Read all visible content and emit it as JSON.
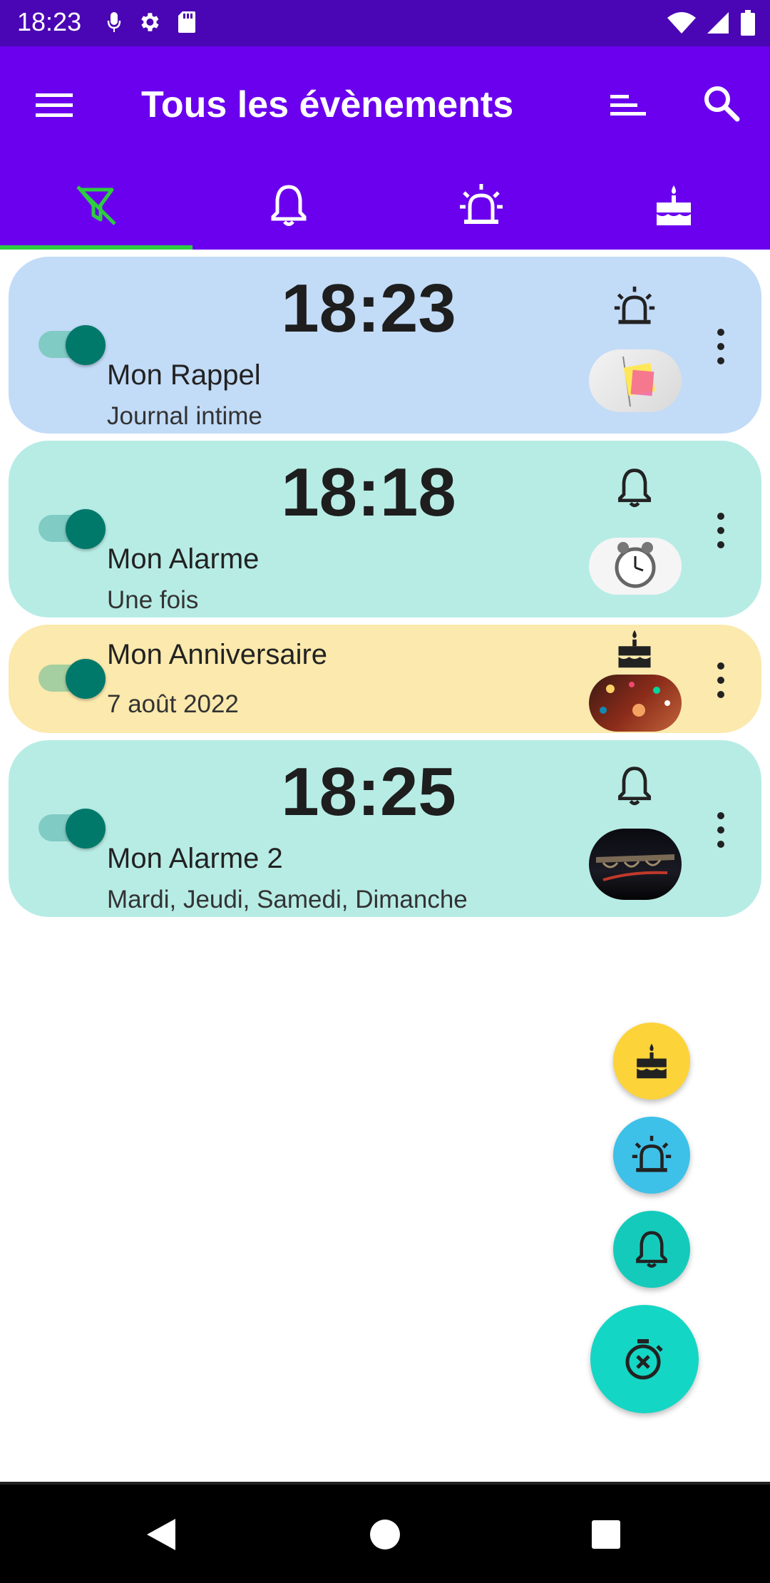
{
  "status_bar": {
    "time": "18:23",
    "left_icons": [
      "mic-icon",
      "settings-icon",
      "sd-card-icon"
    ],
    "right_icons": [
      "wifi-icon",
      "signal-icon",
      "battery-icon"
    ]
  },
  "app_bar": {
    "title": "Tous les évènements",
    "menu_icon": "menu-icon",
    "sort_icon": "sort-icon",
    "search_icon": "search-icon"
  },
  "tabs": [
    {
      "icon": "filter-off-icon",
      "selected": true
    },
    {
      "icon": "bell-icon",
      "selected": false
    },
    {
      "icon": "siren-icon",
      "selected": false
    },
    {
      "icon": "cake-icon",
      "selected": false
    }
  ],
  "events": [
    {
      "time": "18:23",
      "name": "Mon Rappel",
      "detail": "Journal intime",
      "type_icon": "siren-icon",
      "enabled": true,
      "color": "#c2dbf7",
      "thumb": "sticky-note"
    },
    {
      "time": "18:18",
      "name": "Mon Alarme",
      "detail": "Une fois",
      "type_icon": "bell-icon",
      "enabled": true,
      "color": "#b7ece5",
      "thumb": "alarm-clock"
    },
    {
      "time": "",
      "name": "Mon Anniversaire",
      "detail": "7 août 2022",
      "type_icon": "cake-icon",
      "enabled": true,
      "color": "#fbe9ad",
      "thumb": "party"
    },
    {
      "time": "18:25",
      "name": "Mon Alarme 2",
      "detail": "Mardi, Jeudi, Samedi, Dimanche",
      "type_icon": "bell-icon",
      "enabled": true,
      "color": "#b7ece5",
      "thumb": "night-bridge"
    }
  ],
  "fabs": [
    {
      "icon": "cake-icon",
      "color": "#fdd33a"
    },
    {
      "icon": "siren-icon",
      "color": "#3ec1e8"
    },
    {
      "icon": "bell-icon",
      "color": "#14cbbb"
    },
    {
      "icon": "timer-off-icon",
      "color": "#14d6c4"
    }
  ],
  "nav_bar": [
    "back-icon",
    "home-icon",
    "recents-icon"
  ]
}
